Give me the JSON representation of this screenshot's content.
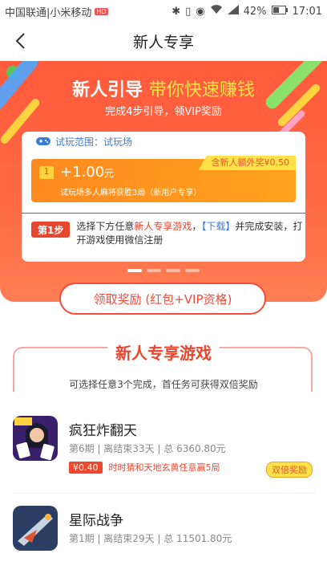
{
  "status_bar": {
    "carrier": "中国联通|小米移动",
    "hd": "HD",
    "battery": "42%",
    "time": "17:01"
  },
  "nav": {
    "title": "新人专享"
  },
  "hero": {
    "title_bold": "新人引导",
    "title_highlight": "带你快速赚钱",
    "subtitle": "完成4步引导，领VIP奖励"
  },
  "card": {
    "scope_label": "试玩范围：试玩场",
    "task_number": "1",
    "reward_amount": "+1.00",
    "reward_unit": "元",
    "task_desc": "试玩场多人麻将获胜3局（新用户专享）",
    "extra_bonus": "含新人额外奖¥0.50",
    "step_tag": "第1步",
    "step_text_1": "选择下方任意",
    "step_text_red": "新人专享游戏",
    "step_text_2": "，",
    "step_text_blue": "【下载】",
    "step_text_3": "并完成安装，打开游戏使用微信注册"
  },
  "carousel": {
    "active_index": 0,
    "count": 4
  },
  "claim_button": "领取奖励 (红包+VIP资格)",
  "games_section": {
    "title": "新人专享游戏",
    "subtitle": "可选择任意3个完成，首任务可获得双倍奖励"
  },
  "games": [
    {
      "name": "疯狂炸翻天",
      "meta": "第6期 | 离结束33天 | 总 6360.80元",
      "price": "¥0.40",
      "task": "时时猜和天地玄黄任意赢5局",
      "badge": "双倍奖励"
    },
    {
      "name": "星际战争",
      "meta": "第1期 | 离结束29天 | 总 11501.80元"
    }
  ],
  "colors": {
    "accent": "#f24c3a",
    "hero": "#ff5a3c",
    "blue": "#3b7bd8",
    "yellow": "#ffe24a"
  }
}
